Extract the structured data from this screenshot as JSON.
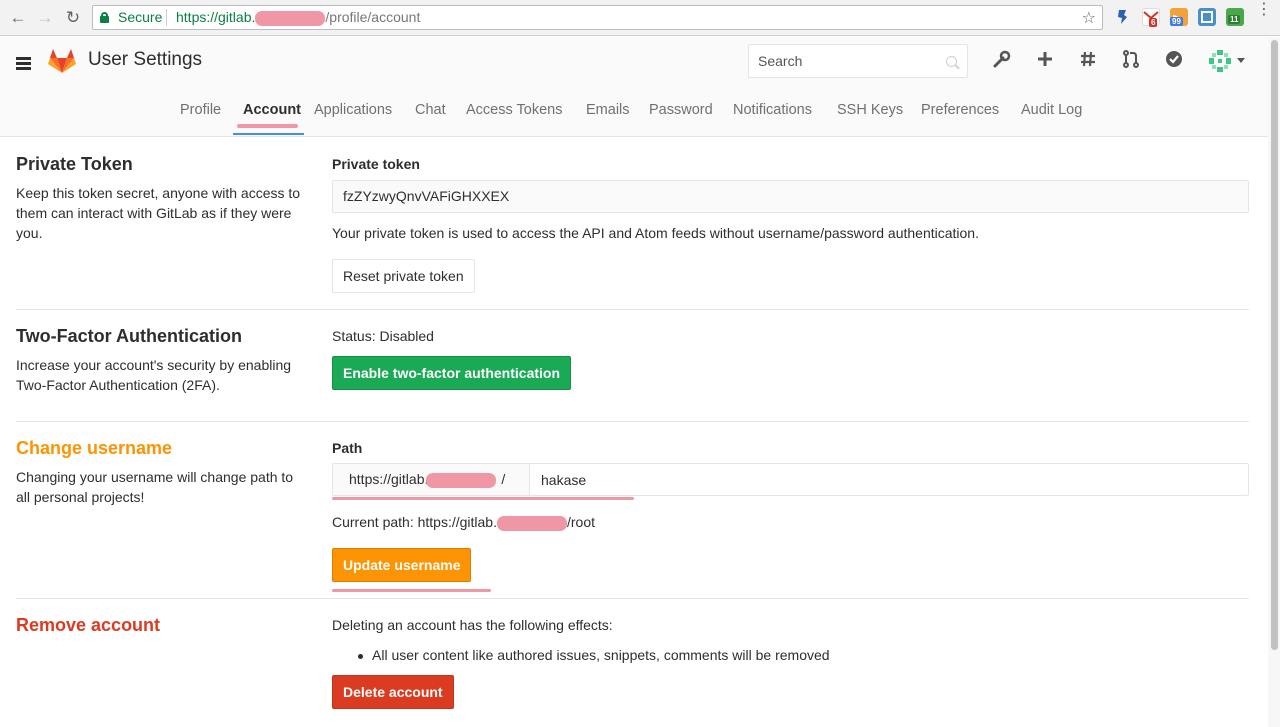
{
  "browser": {
    "secure_label": "Secure",
    "url_scheme": "https://gitlab.",
    "url_path": "/profile/account",
    "ext_badges": [
      "6",
      "99",
      "11"
    ]
  },
  "header": {
    "title": "User Settings",
    "search_placeholder": "Search",
    "icons": [
      "wrench-icon",
      "plus-icon",
      "hash-icon",
      "merge-request-icon",
      "todo-check-icon"
    ]
  },
  "tabs": [
    {
      "label": "Profile",
      "active": false
    },
    {
      "label": "Account",
      "active": true
    },
    {
      "label": "Applications",
      "active": false
    },
    {
      "label": "Chat",
      "active": false
    },
    {
      "label": "Access Tokens",
      "active": false
    },
    {
      "label": "Emails",
      "active": false
    },
    {
      "label": "Password",
      "active": false
    },
    {
      "label": "Notifications",
      "active": false
    },
    {
      "label": "SSH Keys",
      "active": false
    },
    {
      "label": "Preferences",
      "active": false
    },
    {
      "label": "Audit Log",
      "active": false
    }
  ],
  "private_token": {
    "title": "Private Token",
    "description": "Keep this token secret, anyone with access to them can interact with GitLab as if they were you.",
    "label": "Private token",
    "value": "fzZYzwyQnvVAFiGHXXEX",
    "help": "Your private token is used to access the API and Atom feeds without username/password authentication.",
    "reset_button": "Reset private token"
  },
  "two_factor": {
    "title": "Two-Factor Authentication",
    "description": "Increase your account's security by enabling Two-Factor Authentication (2FA).",
    "status": "Status: Disabled",
    "enable_button": "Enable two-factor authentication"
  },
  "change_username": {
    "title": "Change username",
    "description": "Changing your username will change path to all personal projects!",
    "label": "Path",
    "prefix_start": "https://gitlab.",
    "prefix_end": "/",
    "username": "hakase",
    "current_path_start": "Current path: https://gitlab.",
    "current_path_end": "/root",
    "update_button": "Update username"
  },
  "remove_account": {
    "title": "Remove account",
    "intro": "Deleting an account has the following effects:",
    "effects": [
      "All user content like authored issues, snippets, comments will be removed"
    ],
    "delete_button": "Delete account"
  },
  "colors": {
    "success": "#1aaa55",
    "warning": "#fc9403",
    "danger": "#db3b21",
    "tab_active_underline": "#4a8bee",
    "annotation_pink": "#f097a6"
  }
}
